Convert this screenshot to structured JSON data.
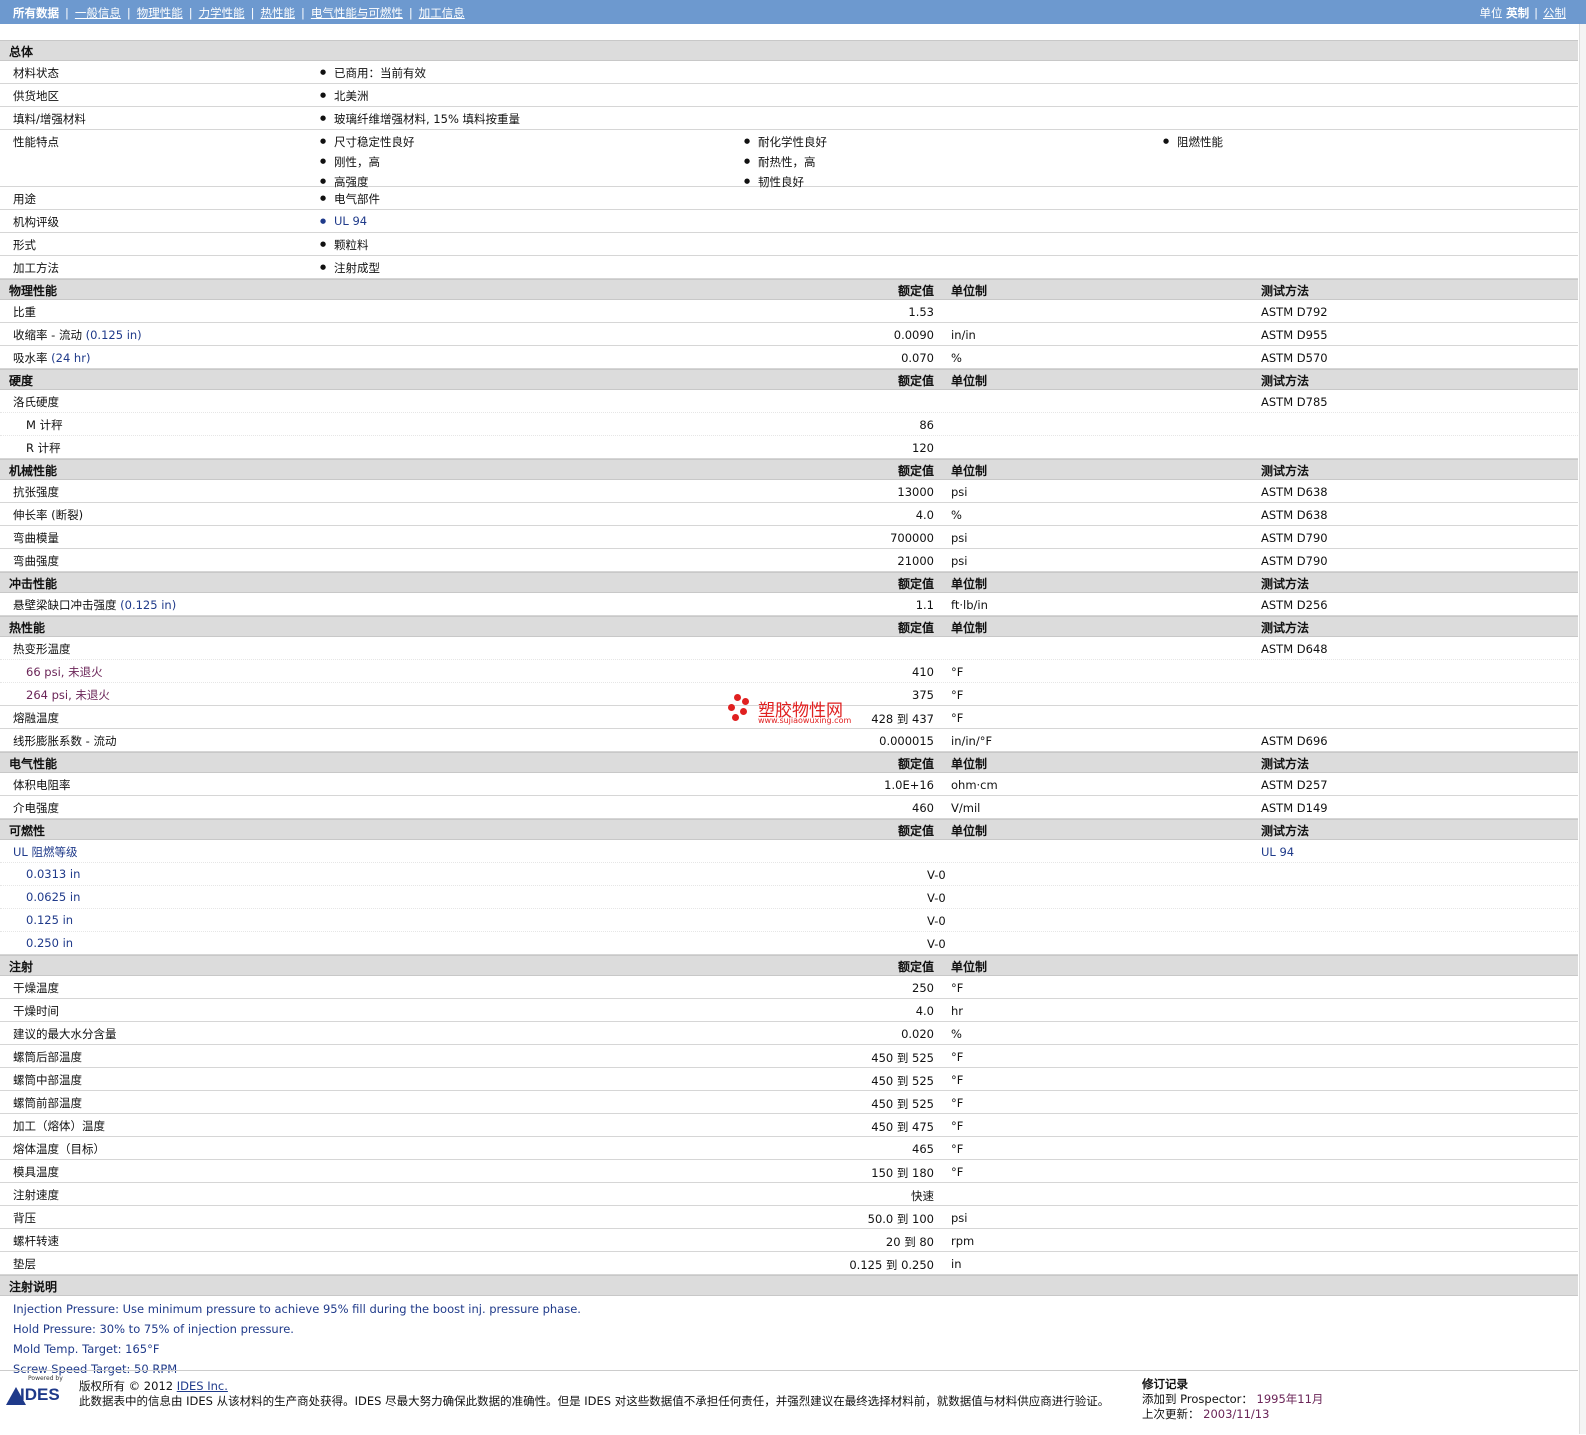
{
  "nav": {
    "items": [
      "所有数据",
      "一般信息",
      "物理性能",
      "力学性能",
      "热性能",
      "电气性能与可燃性",
      "加工信息"
    ],
    "units_label": "单位",
    "unit_imperial": "英制",
    "unit_metric": "公制"
  },
  "general": {
    "title": "总体",
    "status_label": "材料状态",
    "status_value": "已商用：当前有效",
    "region_label": "供货地区",
    "region_value": "北美洲",
    "filler_label": "填料/增强材料",
    "filler_value": "玻璃纤维增强材料, 15% 填料按重量",
    "features_label": "性能特点",
    "features": [
      "尺寸稳定性良好",
      "刚性，高",
      "高强度",
      "耐化学性良好",
      "耐热性，高",
      "韧性良好",
      "阻燃性能"
    ],
    "uses_label": "用途",
    "uses_value": "电气部件",
    "agency_label": "机构评级",
    "agency_value": "UL 94",
    "form_label": "形式",
    "form_value": "颗粒料",
    "process_label": "加工方法",
    "process_value": "注射成型"
  },
  "col": {
    "nominal": "额定值",
    "unit": "单位制",
    "method": "测试方法"
  },
  "physical": {
    "title": "物理性能",
    "r1": {
      "label": "比重",
      "value": "1.53",
      "unit": "",
      "method": "ASTM D792"
    },
    "r2": {
      "label": "收缩率 - 流动",
      "cond": "(0.125 in)",
      "value": "0.0090",
      "unit": "in/in",
      "method": "ASTM D955"
    },
    "r3": {
      "label": "吸水率",
      "cond": "(24 hr)",
      "value": "0.070",
      "unit": "%",
      "method": "ASTM D570"
    }
  },
  "hardness": {
    "title": "硬度",
    "r1": {
      "label": "洛氏硬度",
      "method": "ASTM D785"
    },
    "r2": {
      "label": "M 计秤",
      "value": "86"
    },
    "r3": {
      "label": "R 计秤",
      "value": "120"
    }
  },
  "mechanical": {
    "title": "机械性能",
    "r1": {
      "label": "抗张强度",
      "value": "13000",
      "unit": "psi",
      "method": "ASTM D638"
    },
    "r2": {
      "label": "伸长率 (断裂)",
      "value": "4.0",
      "unit": "%",
      "method": "ASTM D638"
    },
    "r3": {
      "label": "弯曲模量",
      "value": "700000",
      "unit": "psi",
      "method": "ASTM D790"
    },
    "r4": {
      "label": "弯曲强度",
      "value": "21000",
      "unit": "psi",
      "method": "ASTM D790"
    }
  },
  "impact": {
    "title": "冲击性能",
    "r1": {
      "label": "悬壁梁缺口冲击强度",
      "cond": "(0.125 in)",
      "value": "1.1",
      "unit": "ft·lb/in",
      "method": "ASTM D256"
    }
  },
  "thermal": {
    "title": "热性能",
    "r1": {
      "label": "热变形温度",
      "method": "ASTM D648"
    },
    "r2": {
      "label": "66 psi, 未退火",
      "value": "410",
      "unit": "°F"
    },
    "r3": {
      "label": "264 psi, 未退火",
      "value": "375",
      "unit": "°F"
    },
    "r4": {
      "label": "熔融温度",
      "value": "428 到  437",
      "unit": "°F"
    },
    "r5": {
      "label": "线形膨胀系数 - 流动",
      "value": "0.000015",
      "unit": "in/in/°F",
      "method": "ASTM D696"
    }
  },
  "electrical": {
    "title": "电气性能",
    "r1": {
      "label": "体积电阻率",
      "value": "1.0E+16",
      "unit": "ohm·cm",
      "method": "ASTM D257"
    },
    "r2": {
      "label": "介电强度",
      "value": "460",
      "unit": "V/mil",
      "method": "ASTM D149"
    }
  },
  "flammability": {
    "title": "可燃性",
    "r1": {
      "label": "UL 阻燃等级",
      "method": "UL 94"
    },
    "r2": {
      "label": "0.0313 in",
      "value": "V-0"
    },
    "r3": {
      "label": "0.0625 in",
      "value": "V-0"
    },
    "r4": {
      "label": "0.125 in",
      "value": "V-0"
    },
    "r5": {
      "label": "0.250 in",
      "value": "V-0"
    }
  },
  "injection": {
    "title": "注射",
    "r1": {
      "label": "干燥温度",
      "value": "250",
      "unit": "°F"
    },
    "r2": {
      "label": "干燥时间",
      "value": "4.0",
      "unit": "hr"
    },
    "r3": {
      "label": "建议的最大水分含量",
      "value": "0.020",
      "unit": "%"
    },
    "r4": {
      "label": "螺筒后部温度",
      "value": "450 到  525",
      "unit": "°F"
    },
    "r5": {
      "label": "螺筒中部温度",
      "value": "450 到  525",
      "unit": "°F"
    },
    "r6": {
      "label": "螺筒前部温度",
      "value": "450 到  525",
      "unit": "°F"
    },
    "r7": {
      "label": "加工（熔体）温度",
      "value": "450 到  475",
      "unit": "°F"
    },
    "r8": {
      "label": "熔体温度（目标）",
      "value": "465",
      "unit": "°F"
    },
    "r9": {
      "label": "模具温度",
      "value": "150 到  180",
      "unit": "°F"
    },
    "r10": {
      "label": "注射速度",
      "value": "快速",
      "unit": ""
    },
    "r11": {
      "label": "背压",
      "value": "50.0 到  100",
      "unit": "psi"
    },
    "r12": {
      "label": "螺杆转速",
      "value": "20 到  80",
      "unit": "rpm"
    },
    "r13": {
      "label": "垫层",
      "value": "0.125 到  0.250",
      "unit": "in"
    }
  },
  "notes": {
    "title": "注射说明",
    "lines": [
      "Injection Pressure: Use minimum pressure to achieve 95% fill during the boost inj. pressure phase.",
      "Hold Pressure: 30% to 75% of injection pressure.",
      "Mold Temp. Target: 165°F",
      "Screw Speed Target: 50 RPM"
    ]
  },
  "footer": {
    "logo_powered": "Powered by",
    "logo_text": "IDES",
    "copyright": "版权所有 © 2012",
    "company_link": "IDES Inc.",
    "disclaimer": "此数据表中的信息由 IDES 从该材料的生产商处获得。IDES 尽最大努力确保此数据的准确性。但是 IDES 对这些数据值不承担任何责任，并强烈建议在最终选择材料前，就数据值与材料供应商进行验证。",
    "rev_title": "修订记录",
    "added_label": "添加到 Prospector：",
    "added_value": "1995年11月",
    "updated_label": "上次更新：",
    "updated_value": "2003/11/13"
  },
  "watermark": {
    "title": "塑胶物性网",
    "url": "www.sujiaowuxing.com",
    "color": "#e02020"
  }
}
